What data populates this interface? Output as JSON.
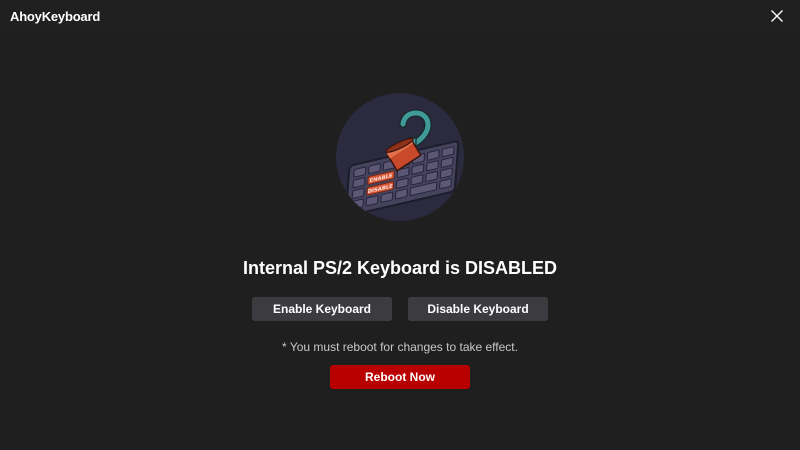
{
  "window": {
    "title": "AhoyKeyboard"
  },
  "main": {
    "status_text": "Internal PS/2 Keyboard is DISABLED",
    "enable_label": "Enable Keyboard",
    "disable_label": "Disable Keyboard",
    "note": "* You must reboot for changes to take effect.",
    "reboot_label": "Reboot Now",
    "logo_key_enable": "ENABLE",
    "logo_key_disable": "DISABLE"
  },
  "colors": {
    "background": "#1f1f1f",
    "button": "#3c3c40",
    "reboot_button": "#b80000",
    "logo_circle": "#2b2a3f",
    "hook": "#3f9a98",
    "cuff": "#c84a2a"
  },
  "icons": {
    "close": "close-icon",
    "logo": "pirate-hook-keyboard-logo"
  }
}
